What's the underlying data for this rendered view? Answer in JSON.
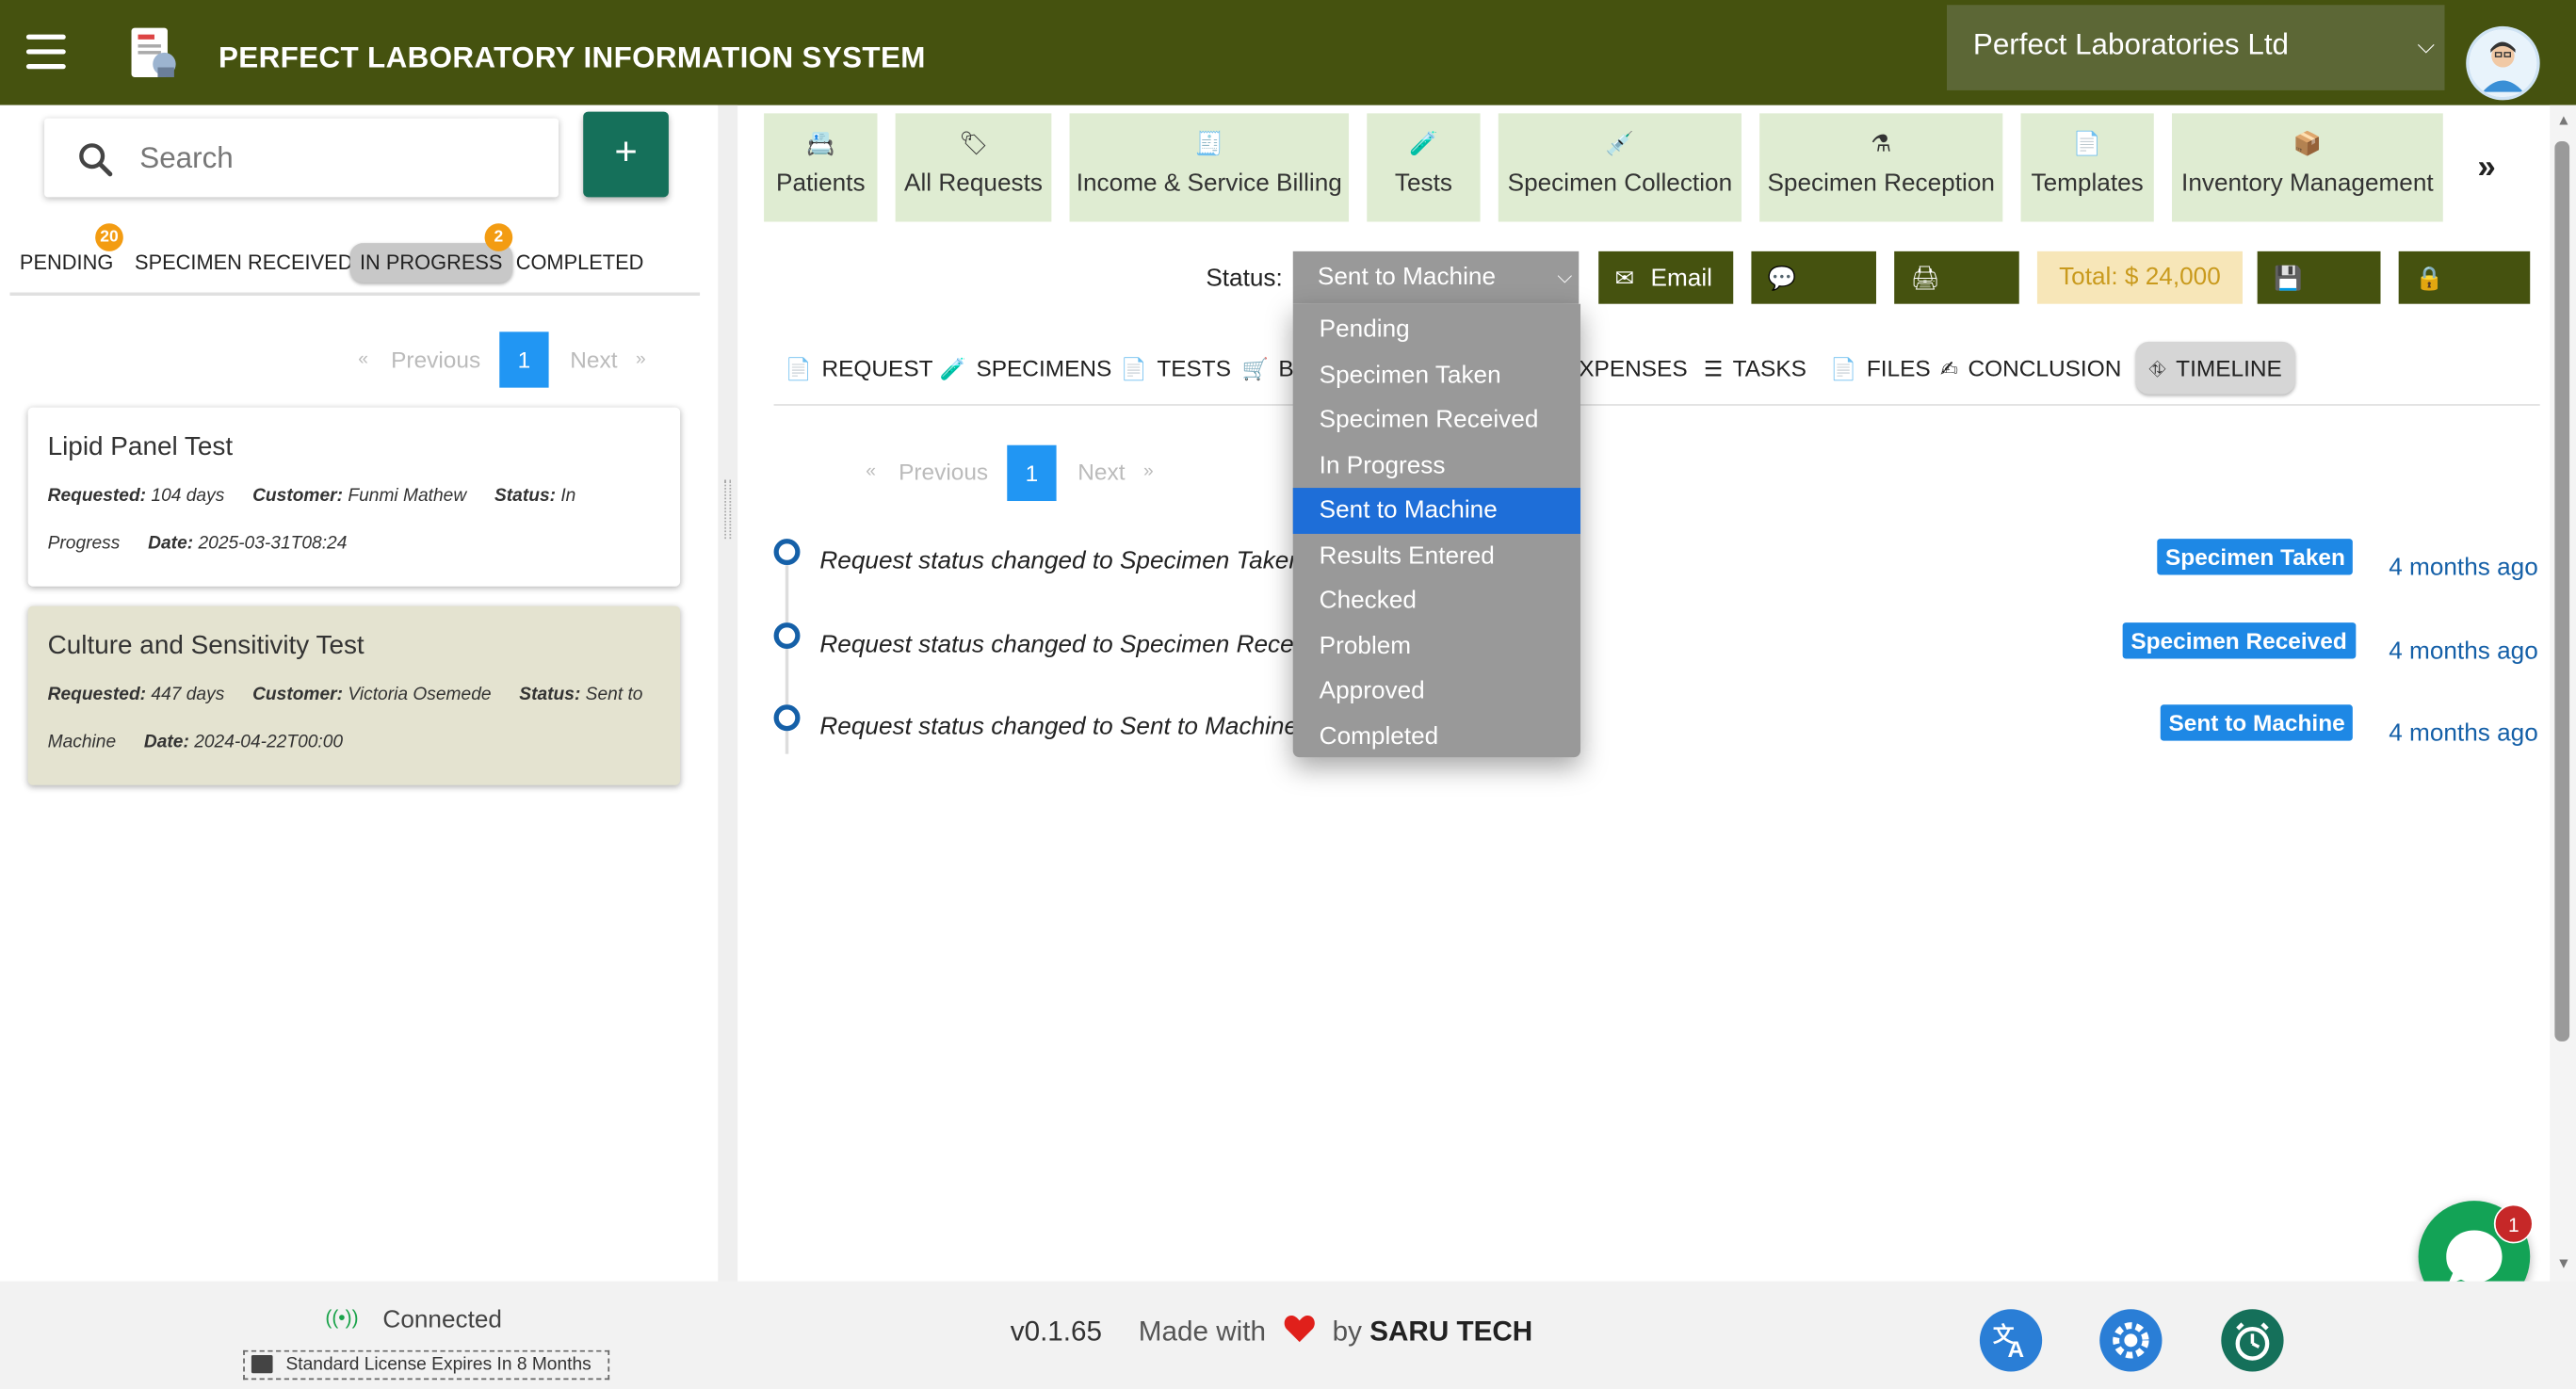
{
  "header": {
    "title": "PERFECT LABORATORY INFORMATION SYSTEM",
    "organization": "Perfect Laboratories Ltd",
    "icons": [
      "menu-icon",
      "app-logo-icon",
      "user-avatar-icon"
    ]
  },
  "sidebar": {
    "search_placeholder": "Search",
    "add_label": "+",
    "filters": [
      {
        "label": "PENDING",
        "count": "20"
      },
      {
        "label": "SPECIMEN RECEIVED"
      },
      {
        "label": "IN PROGRESS",
        "count": "2",
        "active": true
      },
      {
        "label": "COMPLETED"
      }
    ],
    "pager": {
      "prev": "Previous",
      "page": "1",
      "next": "Next",
      "first": "«",
      "last": "»"
    },
    "requests": [
      {
        "title": "Lipid Panel Test",
        "requested_label": "Requested:",
        "requested": "104 days",
        "customer_label": "Customer:",
        "customer": "Funmi Mathew",
        "status_label": "Status:",
        "status": "In Progress",
        "date_label": "Date:",
        "date": "2025-03-31T08:24"
      },
      {
        "title": "Culture and Sensitivity Test",
        "requested_label": "Requested:",
        "requested": "447 days",
        "customer_label": "Customer:",
        "customer": "Victoria Osemede",
        "status_label": "Status:",
        "status": "Sent to Machine",
        "date_label": "Date:",
        "date": "2024-04-22T00:00"
      }
    ]
  },
  "nav": {
    "tiles": [
      {
        "label": "Patients",
        "icon": "id-card-icon"
      },
      {
        "label": "All Requests",
        "icon": "tags-icon"
      },
      {
        "label": "Income & Service Billing",
        "icon": "receipt-icon"
      },
      {
        "label": "Tests",
        "icon": "vials-icon"
      },
      {
        "label": "Specimen Collection",
        "icon": "syringe-icon"
      },
      {
        "label": "Specimen Reception",
        "icon": "flask-icon"
      },
      {
        "label": "Templates",
        "icon": "file-icon"
      },
      {
        "label": "Inventory Management",
        "icon": "boxes-icon"
      }
    ],
    "more": "»"
  },
  "toolbar": {
    "status_label": "Status:",
    "status_value": "Sent to Machine",
    "email": "Email",
    "sms": "SMS",
    "print": "Print",
    "total": "Total: $ 24,000",
    "save": "Save",
    "close": "Close"
  },
  "status_options": [
    "Pending",
    "Specimen Taken",
    "Specimen Received",
    "In Progress",
    "Sent to Machine",
    "Results Entered",
    "Checked",
    "Problem",
    "Approved",
    "Completed"
  ],
  "subtabs": {
    "request": "REQUEST",
    "specimens": "SPECIMENS",
    "tests": "TESTS",
    "billing": "BI",
    "expenses": "XPENSES",
    "tasks": "TASKS",
    "files": "FILES",
    "conclusion": "CONCLUSION",
    "timeline": "TIMELINE"
  },
  "timeline": {
    "pager": {
      "prev": "Previous",
      "page": "1",
      "next": "Next",
      "first": "«",
      "last": "»"
    },
    "events": [
      {
        "text": "Request status changed to Specimen Taken",
        "badge": "Specimen Taken",
        "time": "4 months ago"
      },
      {
        "text": "Request status changed to Specimen Receiv",
        "badge": "Specimen Received",
        "time": "4 months ago"
      },
      {
        "text": "Request status changed to Sent to Machine I",
        "badge": "Sent to Machine",
        "time": "4 months ago"
      }
    ]
  },
  "chat": {
    "badge": "1"
  },
  "footer": {
    "connection": "Connected",
    "license": "Standard License Expires In 8 Months",
    "version": "v0.1.65",
    "made_with": "Made with",
    "by": "by",
    "company": "SARU TECH"
  },
  "colors": {
    "header": "#45520f",
    "tile": "#dfecd2",
    "accent_green": "#15705a",
    "selected_blue": "#1e6ed8",
    "badge_blue": "#1e88e5",
    "total_bg": "#f7e6b8"
  }
}
